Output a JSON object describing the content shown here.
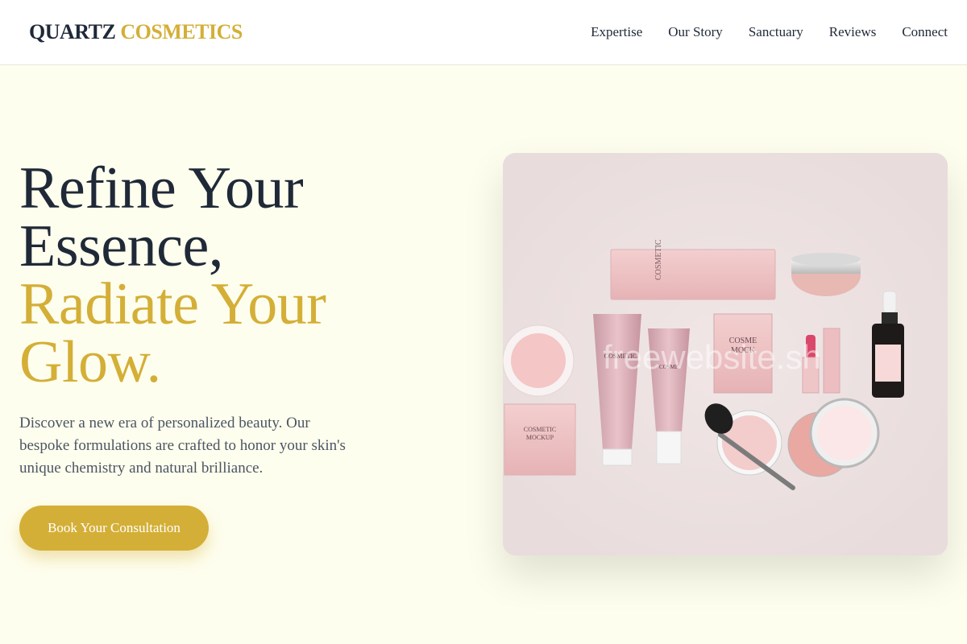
{
  "brand": {
    "part1": "QUARTZ",
    "part2": "COSMETICS"
  },
  "nav": [
    {
      "label": "Expertise"
    },
    {
      "label": "Our Story"
    },
    {
      "label": "Sanctuary"
    },
    {
      "label": "Reviews"
    },
    {
      "label": "Connect"
    }
  ],
  "hero": {
    "line1": "Refine Your",
    "line2": "Essence,",
    "line3": "Radiate Your",
    "line4": "Glow.",
    "description": "Discover a new era of personalized beauty. Our bespoke formulations are crafted to honor your skin's unique chemistry and natural brilliance.",
    "cta": "Book Your Consultation"
  },
  "image": {
    "watermark": "freewebsite.sh",
    "product_label_box": "COSMETIC MOCKUP",
    "product_label_tube": "COSMETIC MOCKUP",
    "product_label_compact": "COSMETIC MOCKUP"
  },
  "colors": {
    "accent": "#d4af37",
    "dark": "#1f2937",
    "bg": "#fefeee"
  }
}
